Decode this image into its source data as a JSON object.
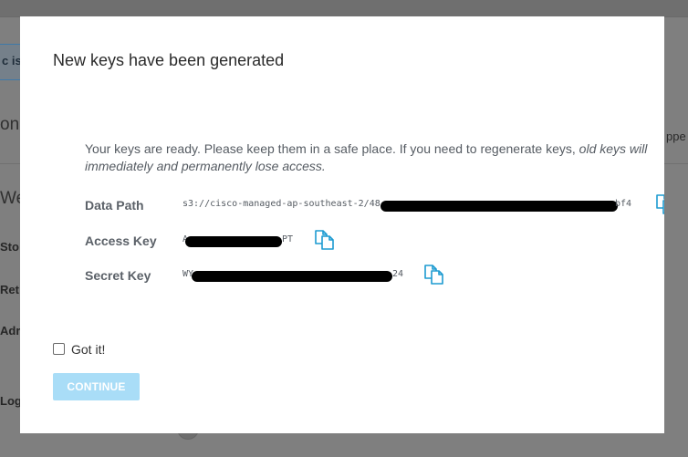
{
  "background": {
    "banner_text": "c is u",
    "section_text": "on",
    "heading_text": "We",
    "fields": [
      "Sto",
      "Ret",
      "Adr",
      "Log"
    ],
    "right_text": "ppe"
  },
  "modal": {
    "title": "New keys have been generated",
    "message_line1": "Your keys are ready. Please keep them in a safe place. If you need to regenerate keys, ",
    "message_line1_emphasis": "old keys will",
    "message_line2_emphasis": "immediately and permanently lose access.",
    "keys": [
      {
        "label": "Data Path",
        "value_prefix": "s3://cisco-managed-ap-southeast-2/48",
        "value_suffix": "bf4"
      },
      {
        "label": "Access Key",
        "value_prefix": "A",
        "value_suffix": "PT"
      },
      {
        "label": "Secret Key",
        "value_prefix": "WY",
        "value_suffix": "24"
      }
    ],
    "checkbox_label": "Got it!",
    "continue_label": "CONTINUE",
    "colors": {
      "accent": "#1d9bd1",
      "continue_disabled": "#a9ddf7",
      "overlay": "#7f7f7f"
    }
  }
}
